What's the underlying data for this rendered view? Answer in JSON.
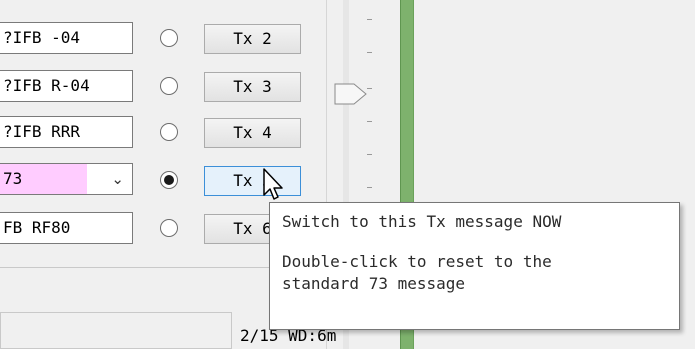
{
  "messages": [
    {
      "text": "?IFB -04",
      "tx_label": "Tx 2",
      "selected": false
    },
    {
      "text": "?IFB R-04",
      "tx_label": "Tx 3",
      "selected": false
    },
    {
      "text": "?IFB RRR",
      "tx_label": "Tx 4",
      "selected": false
    },
    {
      "text": "73",
      "tx_label": "Tx 5",
      "selected": true,
      "combo": true
    },
    {
      "text": "FB RF80",
      "tx_label": "Tx 6",
      "selected": false
    }
  ],
  "combo_arrow_icon": "chevron-down-icon",
  "status": {
    "text": "2/15 WD:6m"
  },
  "tooltip": {
    "line1": "Switch to this Tx message NOW",
    "line2": "Double-click to reset to the",
    "line3": "standard 73 message"
  },
  "colors": {
    "combo_highlight": "#ffccff",
    "hover_button": "#e5f1fb",
    "hover_border": "#3c8fd8",
    "green_bar": "#7eb26d"
  }
}
